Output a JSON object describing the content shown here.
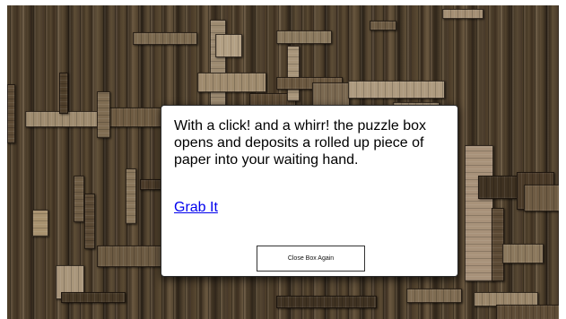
{
  "dialog": {
    "message": "With a click! and a whirr! the puzzle box opens and deposits a rolled up piece of paper into your waiting hand.",
    "grab_link": "Grab It",
    "close_button": "Close Box Again"
  },
  "colors": {
    "wood_dark": "#4a3b28",
    "wood_light": "#a8957a",
    "dialog_bg": "#ffffff",
    "link": "#0000ee"
  }
}
